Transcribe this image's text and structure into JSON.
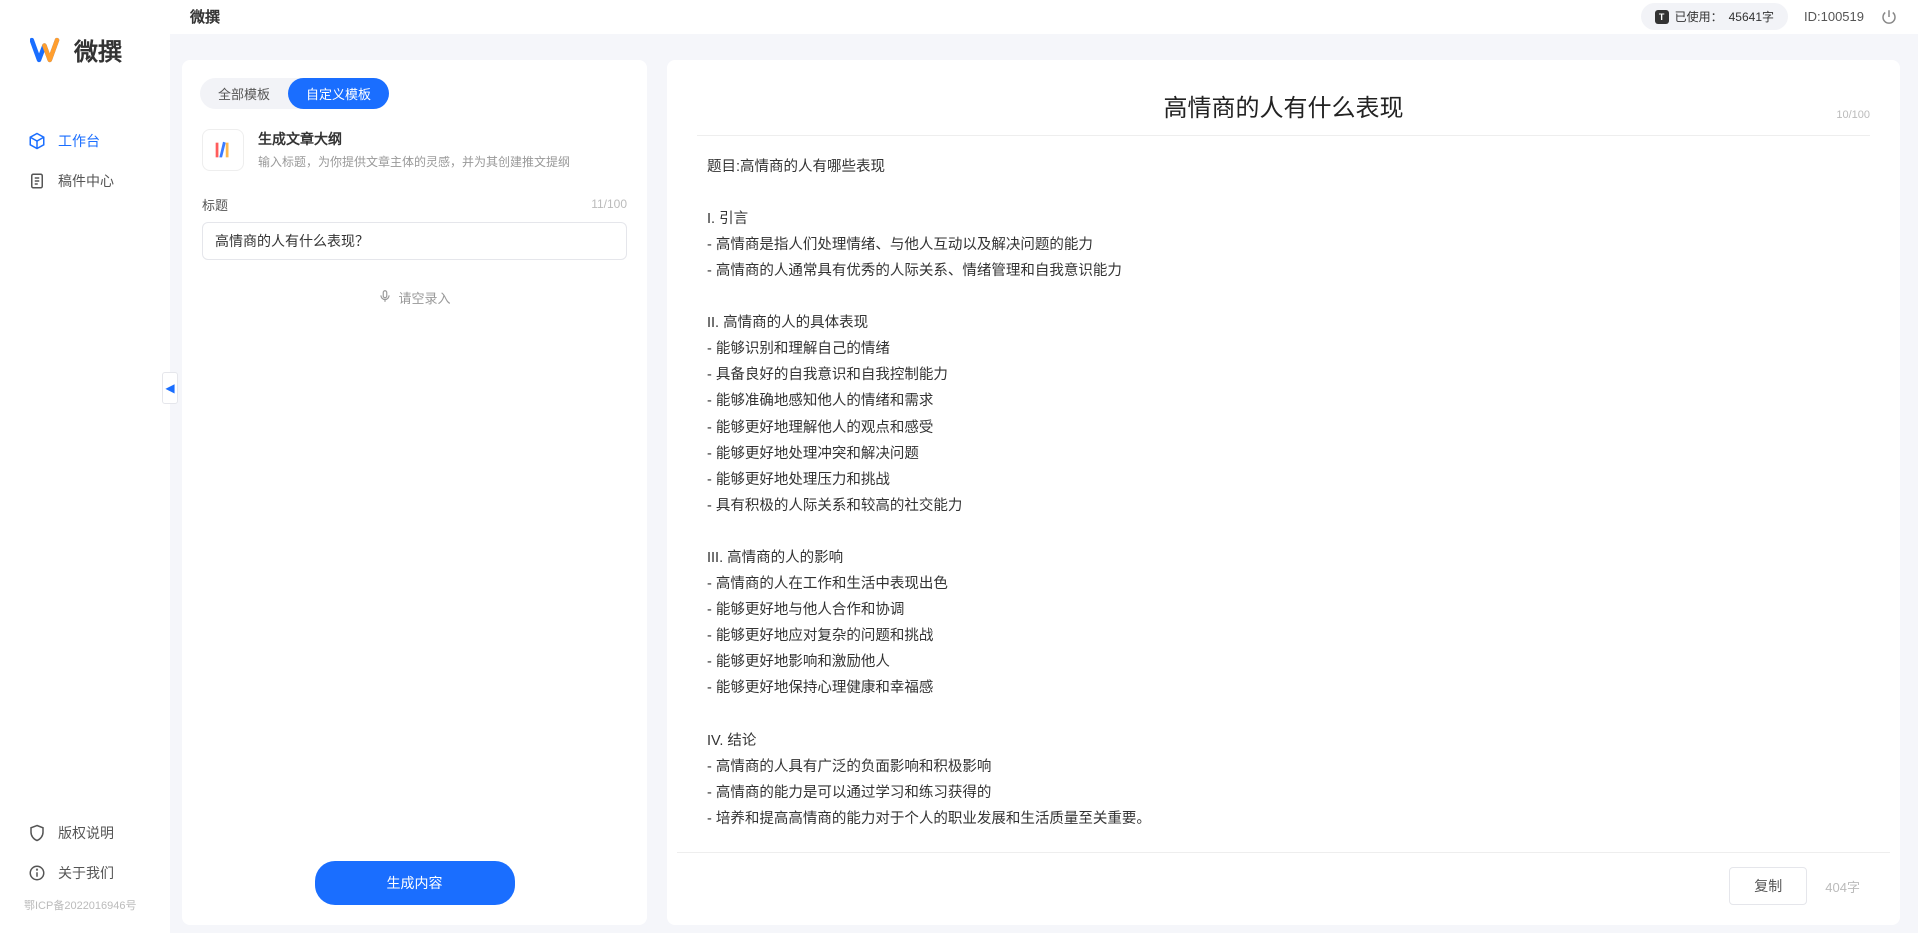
{
  "brand": {
    "name": "微撰"
  },
  "sidebar": {
    "nav": [
      {
        "label": "工作台",
        "active": true,
        "icon": "cube"
      },
      {
        "label": "稿件中心",
        "active": false,
        "icon": "doc"
      }
    ],
    "bottom": [
      {
        "label": "版权说明",
        "icon": "shield"
      },
      {
        "label": "关于我们",
        "icon": "info"
      }
    ],
    "icp": "鄂ICP备2022016946号"
  },
  "topbar": {
    "title": "微撰",
    "usage_label": "已使用：",
    "usage_value": "45641字",
    "id_label": "ID:100519"
  },
  "leftPanel": {
    "tabs": [
      {
        "label": "全部模板",
        "active": false
      },
      {
        "label": "自定义模板",
        "active": true
      }
    ],
    "template": {
      "name": "生成文章大纲",
      "desc": "输入标题，为你提供文章主体的灵感，并为其创建推文提纲"
    },
    "form": {
      "title_label": "标题",
      "title_count": "11/100",
      "title_value": "高情商的人有什么表现？",
      "voice_hint": "请空录入"
    },
    "generate_label": "生成内容"
  },
  "output": {
    "title": "高情商的人有什么表现",
    "title_count": "10/100",
    "body": "题目:高情商的人有哪些表现\n\nI. 引言\n- 高情商是指人们处理情绪、与他人互动以及解决问题的能力\n- 高情商的人通常具有优秀的人际关系、情绪管理和自我意识能力\n\nII. 高情商的人的具体表现\n- 能够识别和理解自己的情绪\n- 具备良好的自我意识和自我控制能力\n- 能够准确地感知他人的情绪和需求\n- 能够更好地理解他人的观点和感受\n- 能够更好地处理冲突和解决问题\n- 能够更好地处理压力和挑战\n- 具有积极的人际关系和较高的社交能力\n\nIII. 高情商的人的影响\n- 高情商的人在工作和生活中表现出色\n- 能够更好地与他人合作和协调\n- 能够更好地应对复杂的问题和挑战\n- 能够更好地影响和激励他人\n- 能够更好地保持心理健康和幸福感\n\nIV. 结论\n- 高情商的人具有广泛的负面影响和积极影响\n- 高情商的能力是可以通过学习和练习获得的\n- 培养和提高高情商的能力对于个人的职业发展和生活质量至关重要。",
    "copy_label": "复制",
    "word_count": "404字"
  }
}
